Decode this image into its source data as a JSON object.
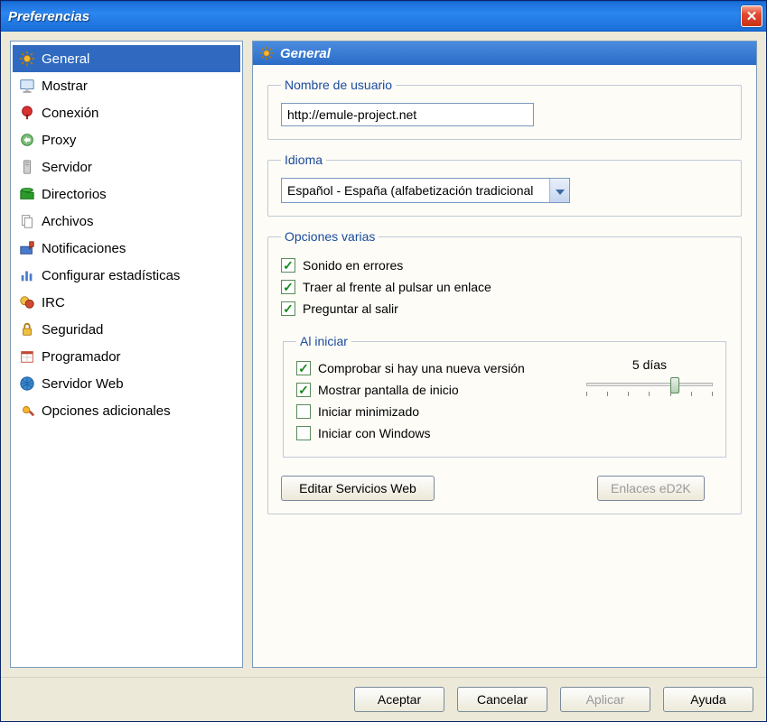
{
  "window": {
    "title": "Preferencias"
  },
  "sidebar": {
    "items": [
      {
        "label": "General",
        "selected": true,
        "icon": "gear-icon"
      },
      {
        "label": "Mostrar",
        "selected": false,
        "icon": "display-icon"
      },
      {
        "label": "Conexión",
        "selected": false,
        "icon": "connection-icon"
      },
      {
        "label": "Proxy",
        "selected": false,
        "icon": "proxy-icon"
      },
      {
        "label": "Servidor",
        "selected": false,
        "icon": "server-icon"
      },
      {
        "label": "Directorios",
        "selected": false,
        "icon": "folder-icon"
      },
      {
        "label": "Archivos",
        "selected": false,
        "icon": "files-icon"
      },
      {
        "label": "Notificaciones",
        "selected": false,
        "icon": "notification-icon"
      },
      {
        "label": "Configurar estadísticas",
        "selected": false,
        "icon": "stats-icon"
      },
      {
        "label": "IRC",
        "selected": false,
        "icon": "irc-icon"
      },
      {
        "label": "Seguridad",
        "selected": false,
        "icon": "lock-icon"
      },
      {
        "label": "Programador",
        "selected": false,
        "icon": "calendar-icon"
      },
      {
        "label": "Servidor Web",
        "selected": false,
        "icon": "globe-icon"
      },
      {
        "label": "Opciones adicionales",
        "selected": false,
        "icon": "tools-icon"
      }
    ]
  },
  "main": {
    "title": "General",
    "username_group": {
      "legend": "Nombre de usuario",
      "value": "http://emule-project.net"
    },
    "language_group": {
      "legend": "Idioma",
      "value": "Español - España (alfabetización tradicional"
    },
    "misc_group": {
      "legend": "Opciones varias",
      "opts": [
        {
          "label": "Sonido en errores",
          "checked": true
        },
        {
          "label": "Traer al frente al pulsar un enlace",
          "checked": true
        },
        {
          "label": "Preguntar al salir",
          "checked": true
        }
      ],
      "startup": {
        "legend": "Al iniciar",
        "slider_label": "5 días",
        "opts": [
          {
            "label": "Comprobar si hay una nueva versión",
            "checked": true
          },
          {
            "label": "Mostrar pantalla de inicio",
            "checked": true
          },
          {
            "label": "Iniciar minimizado",
            "checked": false
          },
          {
            "label": "Iniciar con Windows",
            "checked": false
          }
        ]
      },
      "edit_web_label": "Editar Servicios Web",
      "ed2k_label": "Enlaces eD2K"
    }
  },
  "dialog": {
    "ok": "Aceptar",
    "cancel": "Cancelar",
    "apply": "Aplicar",
    "help": "Ayuda"
  }
}
